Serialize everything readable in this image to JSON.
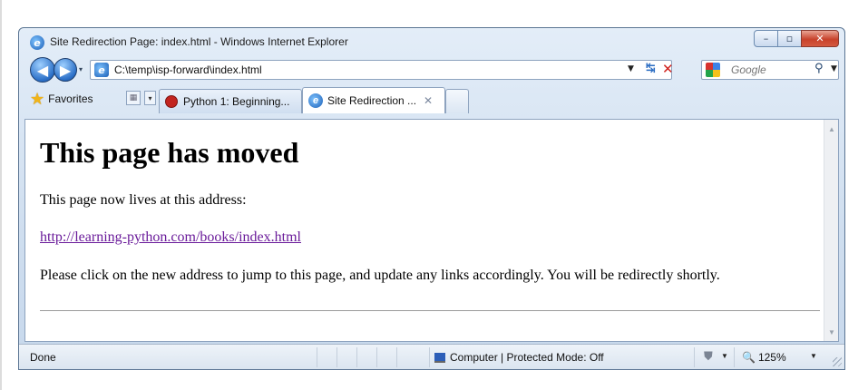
{
  "window": {
    "title": "Site Redirection Page: index.html - Windows Internet Explorer",
    "min_label": "–",
    "max_label": "▫",
    "close_label": "✕"
  },
  "nav": {
    "back_glyph": "◀",
    "forward_glyph": "▶",
    "dropdown_glyph": "▾",
    "address": "C:\\temp\\isp-forward\\index.html",
    "address_drop_glyph": "▼",
    "refresh_glyph": "↹",
    "stop_glyph": "✕",
    "search_placeholder": "Google",
    "search_glyph": "⚲",
    "search_drop_glyph": "▼"
  },
  "tabs": {
    "favorites_label": "Favorites",
    "quick_tabs_glyph": "▦",
    "tab_list_glyph": "▾",
    "items": [
      {
        "label": "Python 1: Beginning..."
      },
      {
        "label": "Site Redirection ...",
        "active": true
      }
    ],
    "close_glyph": "✕"
  },
  "page": {
    "heading": "This page has moved",
    "intro": "This page now lives at this address:",
    "link": "http://learning-python.com/books/index.html",
    "instructions": "Please click on the new address to jump to this page, and update any links accordingly. You will be redirectly shortly."
  },
  "scroll": {
    "up_glyph": "▲",
    "down_glyph": "▼"
  },
  "status": {
    "text": "Done",
    "zone": "Computer | Protected Mode: Off",
    "protected_glyph": "⛊",
    "drop_glyph": "▼",
    "zoom_glyph": "🔍",
    "zoom": "125%"
  },
  "colors": {
    "link_visited": "#6a1b9a",
    "close_button": "#c8422b",
    "chrome_blue": "#cfdeef"
  }
}
